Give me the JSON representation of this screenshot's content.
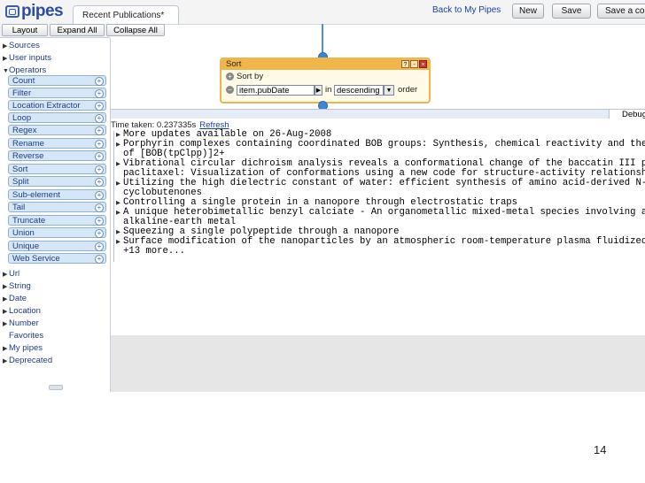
{
  "header": {
    "logo": "pipes",
    "tab_title": "Recent Publications*",
    "back_link": "Back to My Pipes",
    "new_label": "New",
    "save_label": "Save",
    "save_copy_label": "Save a copy"
  },
  "toolbar": {
    "layout_label": "Layout",
    "expand_label": "Expand All",
    "collapse_label": "Collapse All"
  },
  "sidebar": {
    "top_categories": [
      "Sources",
      "User inputs",
      "Operators"
    ],
    "operators": [
      "Count",
      "Filter",
      "Location Extractor",
      "Loop",
      "Regex",
      "Rename",
      "Reverse",
      "Sort",
      "Split",
      "Sub-element",
      "Tail",
      "Truncate",
      "Union",
      "Unique",
      "Web Service"
    ],
    "bottom_categories": [
      "Url",
      "String",
      "Date",
      "Location",
      "Number",
      "Favorites",
      "My pipes",
      "Deprecated"
    ]
  },
  "module": {
    "title": "Sort",
    "sort_by_label": "Sort by",
    "field_value": "item.pubDate",
    "in_label": "in",
    "order_value": "descending",
    "order_label": "order",
    "ctrl_help": "?",
    "ctrl_min": "-",
    "ctrl_close": "×"
  },
  "debugger": {
    "tab_label": "Debugger",
    "time_label": "Time taken: 0.237335s",
    "refresh_label": "Refresh",
    "results": [
      "More updates available on 26-Aug-2008",
      "Porphyrin complexes containing coordinated BOB groups: Synthesis, chemical reactivity and the str",
      "of [BOB(tpClpp)]2+",
      "Vibrational circular dichroism analysis reveals a conformational change of the baccatin III phe",
      "paclitaxel: Visualization of conformations using a new code for structure-activity relationships",
      "Utilizing the high dielectric constant of water: efficient synthesis of amino acid-derived N-pr",
      "cyclobutenones",
      "Controlling a single protein in a nanopore through electrostatic traps",
      "A unique heterobimetallic benzyl calciate - An organometallic mixed-metal species involving an",
      "alkaline-earth metal",
      "Squeezing a single polypeptide through a nanopore",
      "Surface modification of the nanoparticles by an atmospheric room-temperature plasma fluidized b"
    ],
    "more_label": "+13 more..."
  },
  "page_number": "14"
}
